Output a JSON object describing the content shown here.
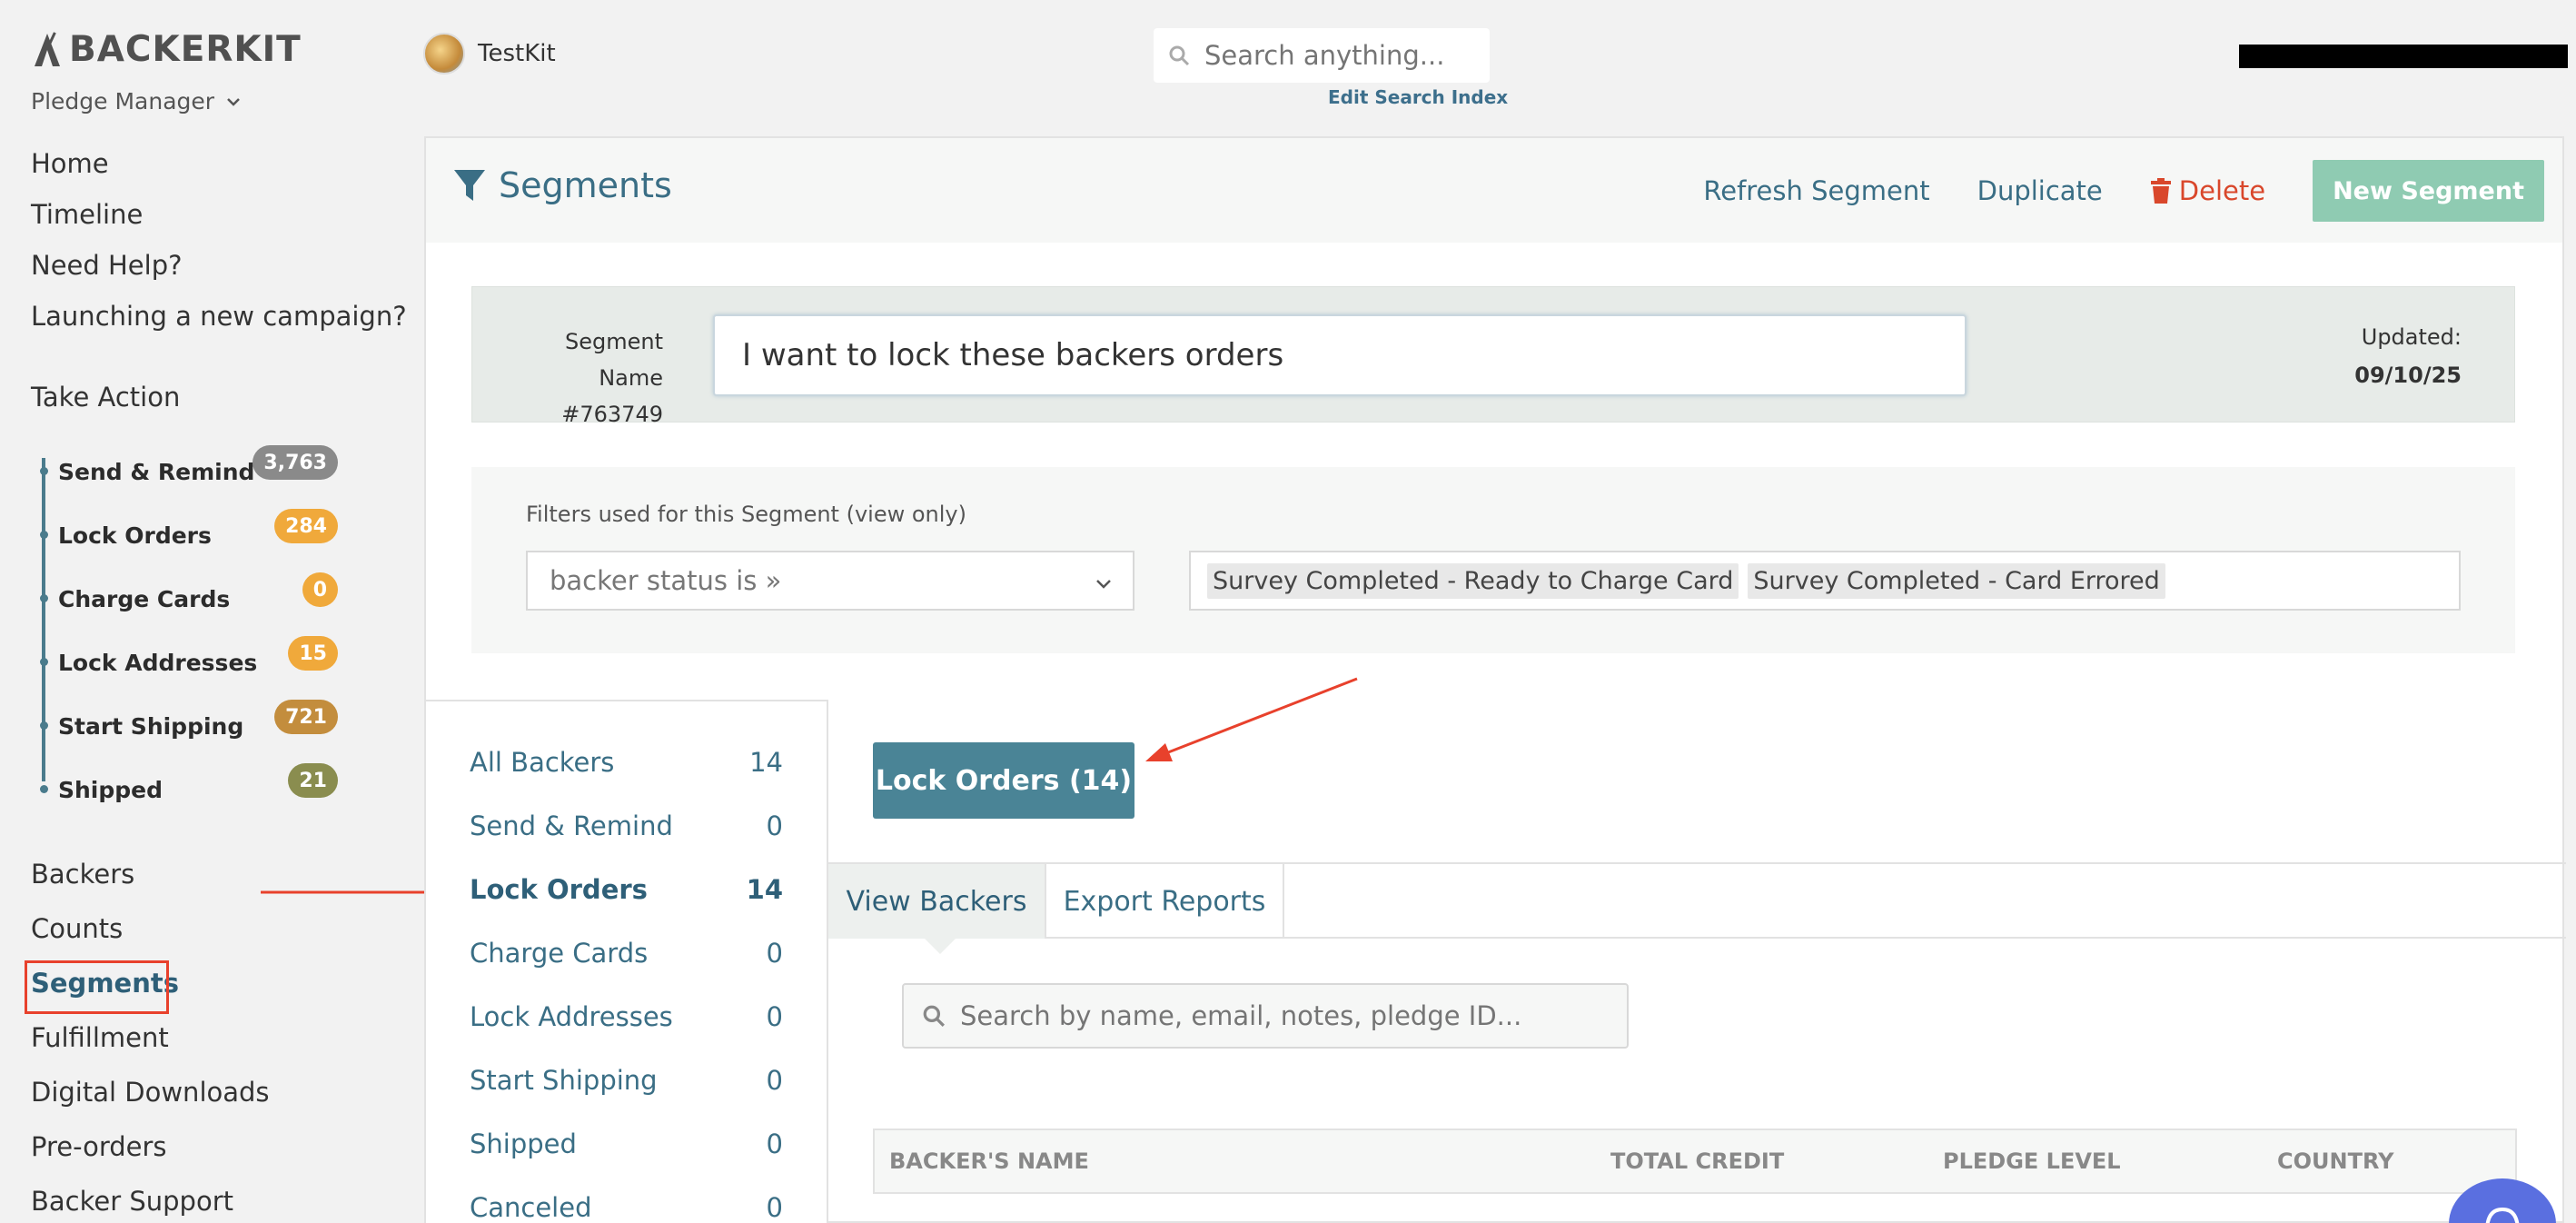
{
  "brand": {
    "logo_text": "BACKERKIT",
    "product": "Pledge Manager"
  },
  "nav_top": [
    "Home",
    "Timeline",
    "Need Help?",
    "Launching a new campaign?"
  ],
  "take_action": {
    "heading": "Take Action",
    "items": [
      {
        "label": "Send & Remind",
        "count": "3,763",
        "color": "#8a8a8a"
      },
      {
        "label": "Lock Orders",
        "count": "284",
        "color": "#f0a93b"
      },
      {
        "label": "Charge Cards",
        "count": "0",
        "color": "#f0a93b"
      },
      {
        "label": "Lock Addresses",
        "count": "15",
        "color": "#f0a93b"
      },
      {
        "label": "Start Shipping",
        "count": "721",
        "color": "#c38d3d"
      },
      {
        "label": "Shipped",
        "count": "21",
        "color": "#8a8d4f"
      }
    ]
  },
  "nav_main": [
    "Backers",
    "Counts",
    "Segments",
    "Fulfillment",
    "Digital Downloads",
    "Pre-orders",
    "Backer Support"
  ],
  "topbar": {
    "kit_name": "TestKit",
    "search_placeholder": "Search anything...",
    "edit_index": "Edit Search Index"
  },
  "header": {
    "title": "Segments",
    "refresh": "Refresh Segment",
    "duplicate": "Duplicate",
    "delete": "Delete",
    "new_segment": "New Segment"
  },
  "segment": {
    "name_label": "Segment Name",
    "id": "#763749",
    "name_value": "I want to lock these backers orders",
    "updated_label": "Updated:",
    "updated_date": "09/10/25"
  },
  "filters": {
    "label": "Filters used for this Segment (view only)",
    "select_value": "backer status is »",
    "tags": [
      "Survey Completed - Ready to Charge Card",
      "Survey Completed - Card Errored"
    ]
  },
  "status_list": [
    {
      "label": "All Backers",
      "count": "14"
    },
    {
      "label": "Send & Remind",
      "count": "0"
    },
    {
      "label": "Lock Orders",
      "count": "14"
    },
    {
      "label": "Charge Cards",
      "count": "0"
    },
    {
      "label": "Lock Addresses",
      "count": "0"
    },
    {
      "label": "Start Shipping",
      "count": "0"
    },
    {
      "label": "Shipped",
      "count": "0"
    },
    {
      "label": "Canceled",
      "count": "0"
    }
  ],
  "action_button": "Lock Orders (14)",
  "tabs": [
    "View Backers",
    "Export Reports"
  ],
  "table": {
    "search_placeholder": "Search by name, email, notes, pledge ID...",
    "columns": [
      "BACKER'S NAME",
      "TOTAL CREDIT",
      "PLEDGE LEVEL",
      "COUNTRY"
    ]
  },
  "colors": {
    "accent": "#3a6e85",
    "annotation": "#e8412c",
    "new_segment": "#8fcbb2",
    "lock_button": "#4a8496"
  }
}
